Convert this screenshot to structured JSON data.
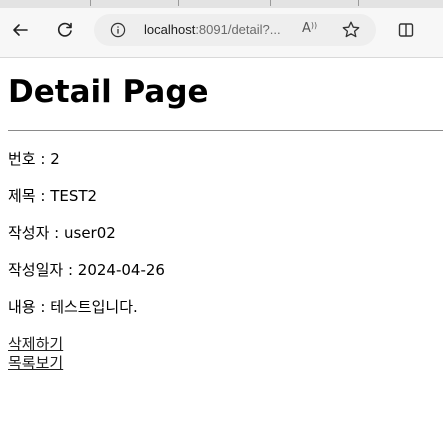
{
  "browser": {
    "url_host": "localhost",
    "url_rest": ":8091/detail?...",
    "read_aloud_glyph": "A"
  },
  "page": {
    "title": "Detail Page",
    "fields": [
      {
        "label": "번호",
        "separator": " : ",
        "value": "2"
      },
      {
        "label": "제목",
        "separator": " : ",
        "value": "TEST2"
      },
      {
        "label": "작성자",
        "separator": " : ",
        "value": "user02"
      },
      {
        "label": "작성일자",
        "separator": " : ",
        "value": "2024-04-26"
      },
      {
        "label": "내용",
        "separator": " : ",
        "value": "테스트입니다."
      }
    ],
    "links": {
      "delete": "삭제하기",
      "list": "목록보기"
    }
  },
  "icons": [
    "back-arrow-icon",
    "reload-icon",
    "info-icon",
    "read-aloud-icon",
    "favorite-star-icon",
    "split-screen-icon"
  ]
}
